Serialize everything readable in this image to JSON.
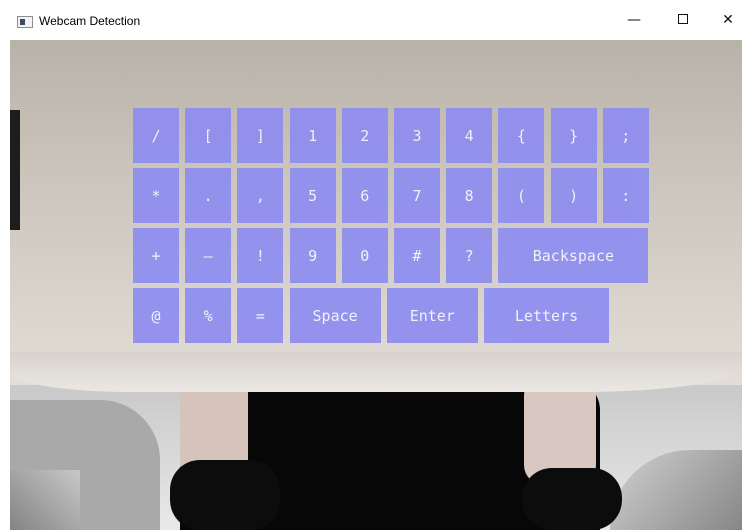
{
  "window": {
    "title": "Webcam Detection",
    "controls": {
      "minimize": "—",
      "maximize": "□",
      "close": "✕"
    }
  },
  "keyboard": {
    "key_color": "#8e8df0",
    "rows": [
      [
        "/",
        "[",
        "]",
        "1",
        "2",
        "3",
        "4",
        "{",
        "}",
        ";"
      ],
      [
        "*",
        ".",
        ",",
        "5",
        "6",
        "7",
        "8",
        "(",
        ")",
        ":"
      ],
      [
        "+",
        "—",
        "!",
        "9",
        "0",
        "#",
        "?",
        "Backspace"
      ],
      [
        "@",
        "%",
        "=",
        "Space",
        "Enter",
        "Letters"
      ]
    ]
  }
}
